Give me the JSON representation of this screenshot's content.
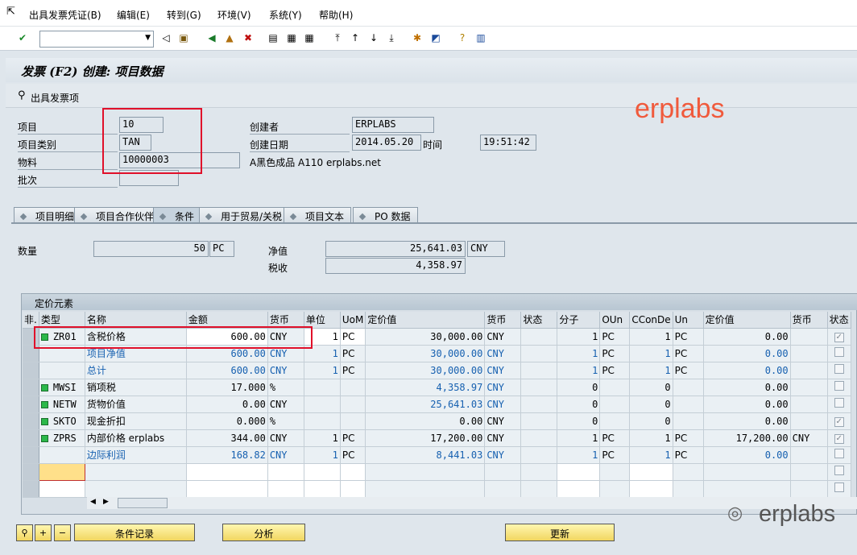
{
  "menu": {
    "items": [
      "出具发票凭证(B)",
      "编辑(E)",
      "转到(G)",
      "环境(V)",
      "系统(Y)",
      "帮助(H)"
    ]
  },
  "toolbar": {
    "command_value": ""
  },
  "title": "发票 (F2) 创建: 项目数据",
  "app_button": "出具发票项",
  "header": {
    "item_label": "项目",
    "item_value": "10",
    "category_label": "项目类别",
    "category_value": "TAN",
    "material_label": "物料",
    "material_value": "10000003",
    "material_desc": "A黑色成品 A110 erplabs.net",
    "batch_label": "批次",
    "batch_value": "",
    "created_by_label": "创建者",
    "created_by_value": "ERPLABS",
    "created_on_label": "创建日期",
    "created_on_value": "2014.05.20",
    "time_label": "时间",
    "time_value": "19:51:42"
  },
  "tabs": [
    "项目明细",
    "项目合作伙伴",
    "条件",
    "用于贸易/关税",
    "项目文本",
    "PO 数据"
  ],
  "active_tab": "条件",
  "summary": {
    "qty_label": "数量",
    "qty_value": "50",
    "qty_unit": "PC",
    "net_label": "净值",
    "net_value": "25,641.03",
    "net_currency": "CNY",
    "tax_label": "税收",
    "tax_value": "4,358.97"
  },
  "pricing": {
    "panel_title": "定价元素",
    "columns": [
      "非.",
      "类型",
      "名称",
      "金额",
      "货币",
      "单位",
      "UoM",
      "定价值",
      "货币",
      "状态",
      "分子",
      "OUn",
      "CConDe",
      "Un",
      "定价值",
      "货币",
      "状态"
    ],
    "rows": [
      {
        "type": "ZR01",
        "status_icon": true,
        "name": "含税价格",
        "amount": "600.00",
        "curr": "CNY",
        "per": "1",
        "uom": "PC",
        "value": "30,000.00",
        "vcurr": "CNY",
        "numer": "1",
        "oun": "PC",
        "denom": "1",
        "un": "PC",
        "value2": "0.00",
        "curr2": "",
        "checked": true,
        "blue": false
      },
      {
        "type": "",
        "status_icon": false,
        "name": "项目净值",
        "amount": "600.00",
        "curr": "CNY",
        "per": "1",
        "uom": "PC",
        "value": "30,000.00",
        "vcurr": "CNY",
        "numer": "1",
        "oun": "PC",
        "denom": "1",
        "un": "PC",
        "value2": "0.00",
        "curr2": "",
        "checked": false,
        "blue": true
      },
      {
        "type": "",
        "status_icon": false,
        "name": "总计",
        "amount": "600.00",
        "curr": "CNY",
        "per": "1",
        "uom": "PC",
        "value": "30,000.00",
        "vcurr": "CNY",
        "numer": "1",
        "oun": "PC",
        "denom": "1",
        "un": "PC",
        "value2": "0.00",
        "curr2": "",
        "checked": false,
        "blue": true
      },
      {
        "type": "MWSI",
        "status_icon": true,
        "name": "销项税",
        "amount": "17.000",
        "curr": "%",
        "per": "",
        "uom": "",
        "value": "4,358.97",
        "vcurr": "CNY",
        "numer": "0",
        "oun": "",
        "denom": "0",
        "un": "",
        "value2": "0.00",
        "curr2": "",
        "checked": false,
        "blue": false,
        "value_blue": true
      },
      {
        "type": "NETW",
        "status_icon": true,
        "name": "货物价值",
        "amount": "0.00",
        "curr": "CNY",
        "per": "",
        "uom": "",
        "value": "25,641.03",
        "vcurr": "CNY",
        "numer": "0",
        "oun": "",
        "denom": "0",
        "un": "",
        "value2": "0.00",
        "curr2": "",
        "checked": false,
        "blue": false,
        "value_blue": true
      },
      {
        "type": "SKTO",
        "status_icon": true,
        "name": "现金折扣",
        "amount": "0.000",
        "curr": "%",
        "per": "",
        "uom": "",
        "value": "0.00",
        "vcurr": "CNY",
        "numer": "0",
        "oun": "",
        "denom": "0",
        "un": "",
        "value2": "0.00",
        "curr2": "",
        "checked": true,
        "blue": false
      },
      {
        "type": "ZPRS",
        "status_icon": true,
        "name": "内部价格 erplabs",
        "amount": "344.00",
        "curr": "CNY",
        "per": "1",
        "uom": "PC",
        "value": "17,200.00",
        "vcurr": "CNY",
        "numer": "1",
        "oun": "PC",
        "denom": "1",
        "un": "PC",
        "value2": "17,200.00",
        "curr2": "CNY",
        "checked": true,
        "blue": false
      },
      {
        "type": "",
        "status_icon": false,
        "name": "边际利润",
        "amount": "168.82",
        "curr": "CNY",
        "per": "1",
        "uom": "PC",
        "value": "8,441.03",
        "vcurr": "CNY",
        "numer": "1",
        "oun": "PC",
        "denom": "1",
        "un": "PC",
        "value2": "0.00",
        "curr2": "",
        "checked": false,
        "blue": true
      }
    ]
  },
  "buttons": {
    "cond_record": "条件记录",
    "analysis": "分析",
    "update": "更新"
  },
  "watermark": {
    "top": "erplabs",
    "bottom": "erplabs"
  },
  "colors": {
    "accent_red": "#e0102a",
    "status_green": "#2bb84a",
    "link_blue": "#1660b0",
    "watermark": "#f05a3c"
  }
}
